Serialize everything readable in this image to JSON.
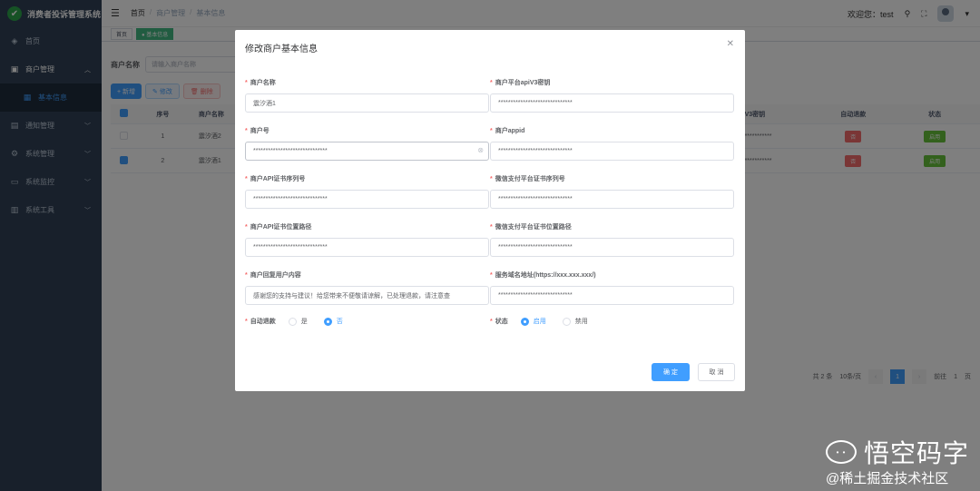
{
  "app": {
    "title": "消费者投诉管理系统"
  },
  "sidebar": {
    "items": [
      {
        "label": "首页",
        "icon": "dashboard-icon"
      },
      {
        "label": "商户管理",
        "icon": "shop-icon"
      },
      {
        "label": "基本信息",
        "icon": "grid-icon"
      },
      {
        "label": "通知管理",
        "icon": "message-icon"
      },
      {
        "label": "系统管理",
        "icon": "gear-icon"
      },
      {
        "label": "系统监控",
        "icon": "monitor-icon"
      },
      {
        "label": "系统工具",
        "icon": "tool-icon"
      }
    ]
  },
  "header": {
    "breadcrumb": [
      "首页",
      "商户管理",
      "基本信息"
    ],
    "welcome": "欢迎您：test"
  },
  "tags": [
    "首页",
    "● 基本信息"
  ],
  "search": {
    "label": "商户名称",
    "placeholder": "请输入商户名称"
  },
  "toolbar": {
    "add": "+ 新增",
    "edit": "✎ 修改",
    "delete": "🗑 删除"
  },
  "table": {
    "columns": [
      "序号",
      "商户名称",
      "V3密钥",
      "自动退款",
      "状态"
    ],
    "rows": [
      {
        "index": "1",
        "name": "震汐酒2",
        "key": "***********",
        "refund": "否",
        "status": "启用",
        "checked": false
      },
      {
        "index": "2",
        "name": "震汐酒1",
        "key": "***********",
        "refund": "否",
        "status": "启用",
        "checked": true
      }
    ]
  },
  "pagination": {
    "total": "共 2 条",
    "page_size": "10条/页",
    "current": "1",
    "goto_label": "前往",
    "goto_value": "1",
    "page_unit": "页"
  },
  "dialog": {
    "title": "修改商户基本信息",
    "fields": {
      "merchant_name": {
        "label": "商户名称",
        "value": "震汐酒1"
      },
      "apiv3_key": {
        "label": "商户平台apiV3密钥",
        "value": "******************************"
      },
      "merchant_no": {
        "label": "商户号",
        "value": "******************************"
      },
      "appid": {
        "label": "商户appid",
        "value": "******************************"
      },
      "api_cert_serial": {
        "label": "商户API证书序列号",
        "value": "******************************"
      },
      "wechat_cert_serial": {
        "label": "微信支付平台证书序列号",
        "value": "******************************"
      },
      "api_cert_path": {
        "label": "商户API证书位置路径",
        "value": "******************************"
      },
      "wechat_cert_path": {
        "label": "微信支付平台证书位置路径",
        "value": "******************************"
      },
      "reply_content": {
        "label": "商户回复用户内容",
        "value": "感谢您的支持与建议！给您带来不便敬请谅解，已处理退款，请注意查"
      },
      "service_domain": {
        "label": "服务域名地址(https://xxx.xxx.xxx/)",
        "value": "******************************"
      }
    },
    "auto_refund": {
      "label": "自动退款",
      "options": [
        "是",
        "否"
      ],
      "selected": "否"
    },
    "status": {
      "label": "状态",
      "options": [
        "启用",
        "禁用"
      ],
      "selected": "启用"
    },
    "confirm": "确 定",
    "cancel": "取 消"
  },
  "watermark": {
    "name": "悟空码字",
    "sub": "@稀土掘金技术社区"
  }
}
